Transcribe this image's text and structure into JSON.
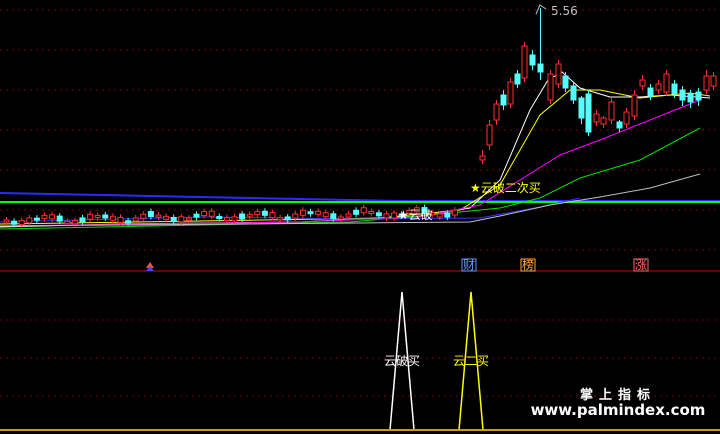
{
  "chart_data": {
    "type": "candlestick",
    "price_panel": {
      "peak_label": "5.56",
      "reference_lines": [
        {
          "name": "blue-line",
          "color": "#2a2aff"
        },
        {
          "name": "green-line",
          "color": "#00ff00"
        }
      ],
      "moving_averages": [
        {
          "name": "white-ma",
          "color": "#ffffff"
        },
        {
          "name": "yellow-ma",
          "color": "#ffff00"
        },
        {
          "name": "magenta-ma",
          "color": "#ff00ff"
        },
        {
          "name": "green-ma",
          "color": "#00dd00"
        },
        {
          "name": "blue-ma",
          "color": "#3333ff"
        },
        {
          "name": "gray-ma",
          "color": "#c0c0c0"
        }
      ],
      "annotations": [
        {
          "text": "★云破二次买",
          "color": "#ffff00"
        },
        {
          "text": "★云破",
          "color": "#ffffff"
        }
      ],
      "event_markers": [
        {
          "text": "财",
          "color": "#6699ff"
        },
        {
          "text": "榜",
          "color": "#ffaa44"
        },
        {
          "text": "涨",
          "color": "#ff6666"
        }
      ]
    },
    "signal_panel": {
      "signals": [
        {
          "label": "云破买",
          "color": "#ffffff"
        },
        {
          "label": "云二买",
          "color": "#ffff00"
        }
      ]
    }
  },
  "watermark": {
    "line1": "掌上指标",
    "line2": "www.palmindex.com"
  }
}
